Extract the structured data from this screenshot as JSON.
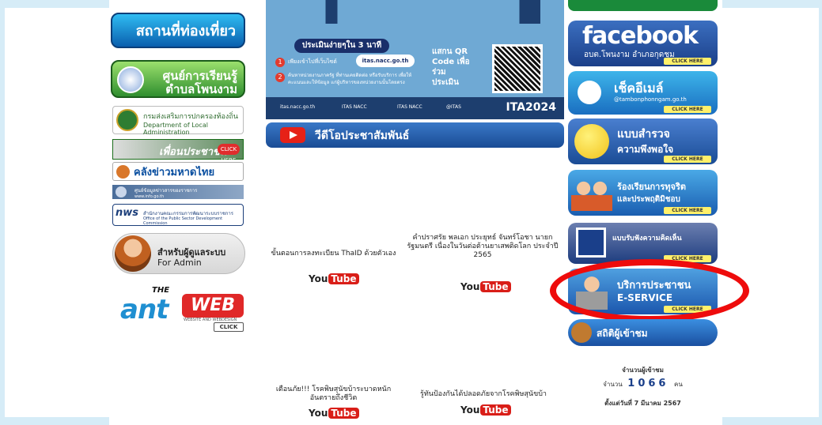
{
  "left": {
    "tourism": "สถานที่ท่องเที่ยว",
    "learning_1": "ศูนย์การเรียนรู้",
    "learning_2": "ตำบลโพนงาม",
    "dla_1": "กรมส่งเสริมการปกครองท้องถิ่น",
    "dla_2": "Department of Local Administration",
    "friend": "เพื่อนประชาชน",
    "friend_click": "CLICK HERE",
    "news": "คลังข่าวมหาดไทย",
    "info_1": "ศูนย์ข้อมูลข่าวสารของราชการ",
    "info_2": "www.info.go.th",
    "ocsc_logo": "nws",
    "ocsc_1": "สำนักงานคณะกรรมการพัฒนาระบบราชการ",
    "ocsc_2": "Office of the Public Sector Development Commission",
    "admin_1": "สำหรับผู้ดูแลระบบ",
    "admin_2": "For Admin",
    "antweb_the": "THE",
    "antweb_ant": "ant",
    "antweb_web": "WEB",
    "antweb_sub": "WEBSITE AND WEBDESIGN",
    "antweb_click": "CLICK"
  },
  "center": {
    "banner_pill": "ประเมินง่ายๆใน 3 นาที",
    "step1_num": "1",
    "step1": "เพียงเข้าไปที่เว็บไซต์",
    "url": "itas.nacc.go.th",
    "step2_num": "2",
    "step2": "ค้นหาหน่วยงานภาครัฐ ที่ท่านเคยติดต่อ หรือรับบริการ เพื่อให้คะแนนและให้ข้อมูล แก่ผู้บริหารของหน่วยงานนั้นโดยตรง",
    "scan": "แสกน QR Code เพื่อร่วม ประเมิน",
    "bar_web": "itas.nacc.go.th",
    "bar_nacc": "ITAS NACC",
    "bar_fb": "ITAS NACC",
    "bar_line": "@ITAS",
    "ita": "ITA2024",
    "video": "วีดีโอประชาสัมพันธ์",
    "vid1": "ขั้นตอนการลงทะเบียน ThaID ด้วยตัวเอง",
    "vid2": "คำปราศรัย พลเอก ประยุทธ์ จันทร์โอชา นายกรัฐมนตรี เนื่องในวันต่อต้านยาเสพติดโลก ประจำปี 2565",
    "vid3": "เตือนภัย!!! โรคพิษสุนัขบ้าระบาดหนัก อันตรายถึงชีวิต",
    "vid4": "รู้ทันป้องกันได้ปลอดภัยจากโรคพิษสุนัขบ้า",
    "yt_you": "You",
    "yt_tube": "Tube"
  },
  "right": {
    "fb_big": "facebook",
    "fb_sub": "อบต.โพนงาม อำเภอกุดชุม",
    "click_here": "CLICK HERE",
    "email_t": "เช็คอีเมล์",
    "email_s": "@tambonphonngam.go.th",
    "survey_1": "แบบสำรวจ",
    "survey_2": "ความพึงพอใจ",
    "corrupt_1": "ร้องเรียนการทุจริต",
    "corrupt_2": "และประพฤติมิชอบ",
    "opinion": "แบบรับฟังความคิดเห็น",
    "eservice_1": "บริการประชาชน",
    "eservice_2": "E-SERVICE",
    "stats": "สถิติผู้เข้าชม",
    "vc_title": "จำนวนผู้เข้าชม",
    "vc_label": "จำนวน",
    "vc_count": "1066",
    "vc_unit": "คน",
    "vc_since": "ตั้งแต่วันที่ 7 มีนาคม 2567"
  },
  "colors": {
    "page_bg": "#d6ecf7",
    "highlight_ring": "#ee0c0c"
  }
}
